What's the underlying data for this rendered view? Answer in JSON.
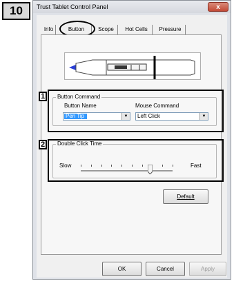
{
  "step_number": "10",
  "window": {
    "title": "Trust Tablet Control Panel",
    "close_glyph": "x"
  },
  "tabs": [
    {
      "label": "Info"
    },
    {
      "label": "Button"
    },
    {
      "label": "Scope"
    },
    {
      "label": "Hot Cells"
    },
    {
      "label": "Pressure"
    }
  ],
  "button_command": {
    "callout_number": "1",
    "group_title": "Button Command",
    "button_name_label": "Button Name",
    "mouse_command_label": "Mouse Command",
    "button_name_value": "Pen Tip",
    "mouse_command_value": "Left Click"
  },
  "double_click": {
    "callout_number": "2",
    "group_title": "Double Click Time",
    "slow_label": "Slow",
    "fast_label": "Fast",
    "slider_level_fraction": 0.75
  },
  "default_button": "Default",
  "footer": {
    "ok": "OK",
    "cancel": "Cancel",
    "apply": "Apply"
  },
  "colors": {
    "selection": "#3399ff",
    "pen_tip": "#2a3fd6",
    "close_button": "#c34a36"
  }
}
